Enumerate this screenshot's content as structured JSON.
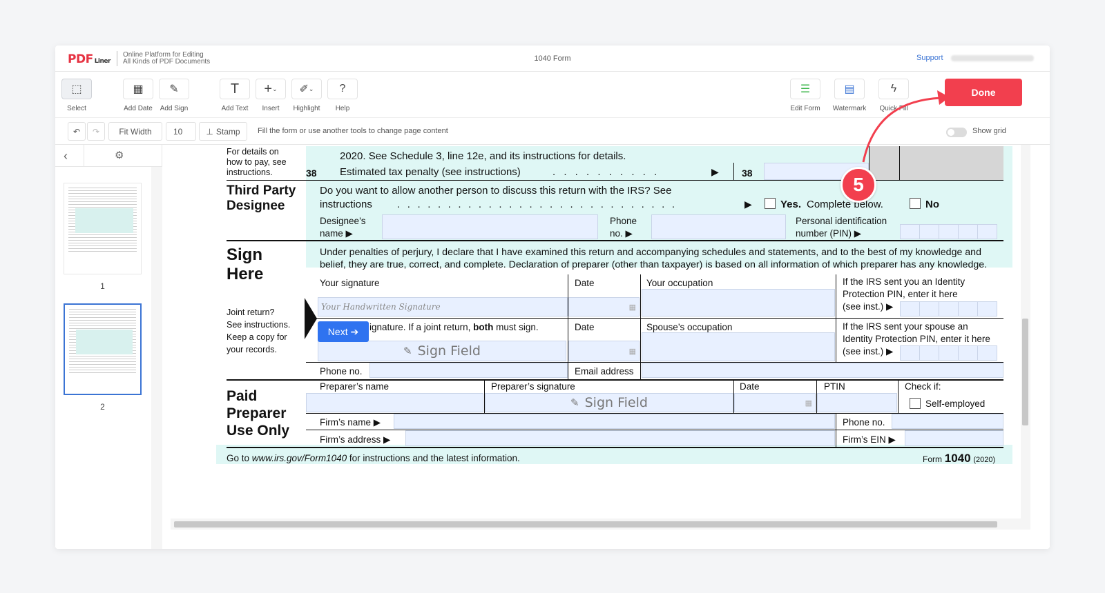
{
  "header": {
    "logo_main": "PDF",
    "logo_sub": "Liner",
    "tagline_line1": "Online Platform for Editing",
    "tagline_line2": "All Kinds of PDF Documents",
    "doc_title": "1040 Form",
    "support_label": "Support"
  },
  "toolbar": {
    "select": "Select",
    "add_date": "Add Date",
    "add_sign": "Add Sign",
    "add_text": "Add Text",
    "insert": "Insert",
    "highlight": "Highlight",
    "help": "Help",
    "edit_form": "Edit Form",
    "watermark": "Watermark",
    "quick_fill": "Quick Fill",
    "done": "Done"
  },
  "row2": {
    "fit_width": "Fit Width",
    "page_value": "10",
    "stamp": "Stamp",
    "hint": "Fill the form or use another tools to change page content",
    "show_grid": "Show grid"
  },
  "sidebar": {
    "pages": [
      "1",
      "2"
    ],
    "selected_page": "2"
  },
  "form": {
    "details_l1": "For details on",
    "details_l2": "how to pay, see",
    "details_l3": "instructions.",
    "line37_text": "2020. See Schedule 3, line 12e, and its instructions for details.",
    "line38_num": "38",
    "line38_text": "Estimated tax penalty (see instructions)",
    "line38_dots": ". . . . . . . . . .",
    "arrow": "▶",
    "third_party_l1": "Third Party",
    "third_party_l2": "Designee",
    "tp_question_l1": "Do you want to allow another person to discuss this return with the IRS? See",
    "tp_question_l2": "instructions",
    "tp_dots": ". . . . . . . . . . . . . . . . . . . . . . . . . . . .",
    "yes_bold": "Yes.",
    "yes_rest": "Complete below.",
    "no": "No",
    "designee_name_l1": "Designee’s",
    "designee_name_l2": "name ▶",
    "phone_l1": "Phone",
    "phone_l2": "no. ▶",
    "pin_l1": "Personal identification",
    "pin_l2": "number (PIN) ▶",
    "sign_l1": "Sign",
    "sign_l2": "Here",
    "perjury_l1": "Under penalties of perjury, I declare that I have examined this return and accompanying schedules and statements, and to the best of my knowledge and",
    "perjury_l2": "belief, they are true, correct, and complete. Declaration of preparer (other than taxpayer) is based on all information of which preparer has any knowledge.",
    "your_signature": "Your signature",
    "date": "Date",
    "your_occupation": "Your occupation",
    "ip_pin_l1": "If the IRS sent you an Identity",
    "ip_pin_l2": "Protection PIN, enter it here",
    "ip_pin_l3": "(see inst.) ▶",
    "handwritten_placeholder": "Your Handwritten Signature",
    "joint_l1": "Joint return?",
    "joint_l2": "See instructions.",
    "joint_l3": "Keep a copy for",
    "joint_l4": "your records.",
    "spouse_sig_a": "ignature. If a joint return,",
    "spouse_sig_b": "both",
    "spouse_sig_c": "must sign.",
    "spouse_occupation": "Spouse’s occupation",
    "spouse_pin_l1": "If the IRS sent your spouse an",
    "spouse_pin_l2": "Identity Protection PIN, enter it here",
    "spouse_pin_l3": "(see inst.) ▶",
    "sign_field": "Sign Field",
    "phone_no": "Phone no.",
    "email_address": "Email address",
    "paid_l1": "Paid",
    "paid_l2": "Preparer",
    "paid_l3": "Use Only",
    "preparer_name": "Preparer’s name",
    "preparer_signature": "Preparer’s signature",
    "ptin": "PTIN",
    "check_if": "Check if:",
    "self_employed": "Self-employed",
    "firm_name": "Firm’s name ▶",
    "firm_phone": "Phone no.",
    "firm_address": "Firm’s address ▶",
    "firm_ein": "Firm’s EIN ▶",
    "footer_goto": "Go to",
    "footer_url": "www.irs.gov/Form1040",
    "footer_rest": "for instructions and the latest information.",
    "footer_form": "Form",
    "footer_formnum": "1040",
    "footer_year": "(2020)"
  },
  "next_button": "Next ➔",
  "step_number": "5",
  "colors": {
    "accent": "#f23f4e",
    "form_bg": "#dff7f5",
    "field_bg": "#e8f0ff",
    "next_blue": "#2f73f0"
  }
}
